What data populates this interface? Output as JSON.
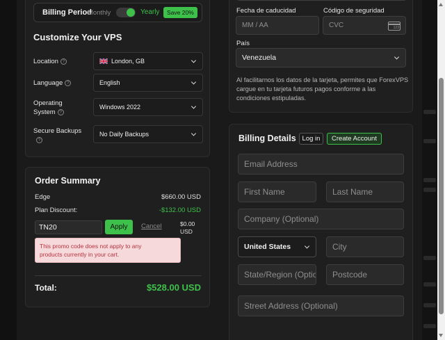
{
  "billing": {
    "label": "Billing Period",
    "monthly": "Monthly",
    "yearly": "Yearly",
    "save_badge": "Save 20%"
  },
  "customize": {
    "title": "Customize Your VPS",
    "location": {
      "label": "Location",
      "value": "London, GB"
    },
    "language": {
      "label": "Language",
      "value": "English"
    },
    "os": {
      "label_line1": "Operating",
      "label_line2": "System",
      "value": "Windows 2022"
    },
    "backups": {
      "label": "Secure Backups",
      "value": "No Daily Backups"
    }
  },
  "order": {
    "title": "Order Summary",
    "edge_label": "Edge",
    "edge_price": "$660.00 USD",
    "discount_label": "Plan Discount:",
    "discount_value": "-$132.00 USD",
    "promo_code": "TN20",
    "apply_label": "Apply",
    "cancel_label": "Cancel",
    "promo_amount_line1": "$0.00",
    "promo_amount_line2": "USD",
    "error_line1": "This promo code does not apply to any",
    "error_line2": "products currently in your cart.",
    "total_label": "Total:",
    "total_value": "$528.00 USD"
  },
  "payment": {
    "expiry_label": "Fecha de caducidad",
    "expiry_placeholder": "MM / AA",
    "cvc_label": "Código de seguridad",
    "cvc_placeholder": "CVC",
    "cvc_card_text": "123",
    "country_label": "País",
    "country_value": "Venezuela",
    "notice_line1": "Al facilitarnos los datos de la tarjeta, permites que ForexVPS",
    "notice_line2": "cargue en tu tarjeta futuros pagos conforme a las",
    "notice_line3": "condiciones estipuladas."
  },
  "billing_details": {
    "title": "Billing Details",
    "login_label": "Log in",
    "create_label": "Create Account",
    "email_placeholder": "Email Address",
    "first_name_placeholder": "First Name",
    "last_name_placeholder": "Last Name",
    "company_placeholder": "Company (Optional)",
    "country_value": "United States",
    "city_placeholder": "City",
    "state_placeholder": "State/Region (Optio",
    "postcode_placeholder": "Postcode",
    "street_placeholder": "Street Address (Optional)"
  },
  "colors": {
    "accent_green": "#3ec14a",
    "error_bg": "#f6d9db",
    "error_text": "#b8333f",
    "background": "#1a1a1a",
    "panel": "#1f1f1f"
  },
  "icons": [
    "uk-flag-icon",
    "help-icon",
    "chevron-down-icon",
    "card-icon"
  ]
}
